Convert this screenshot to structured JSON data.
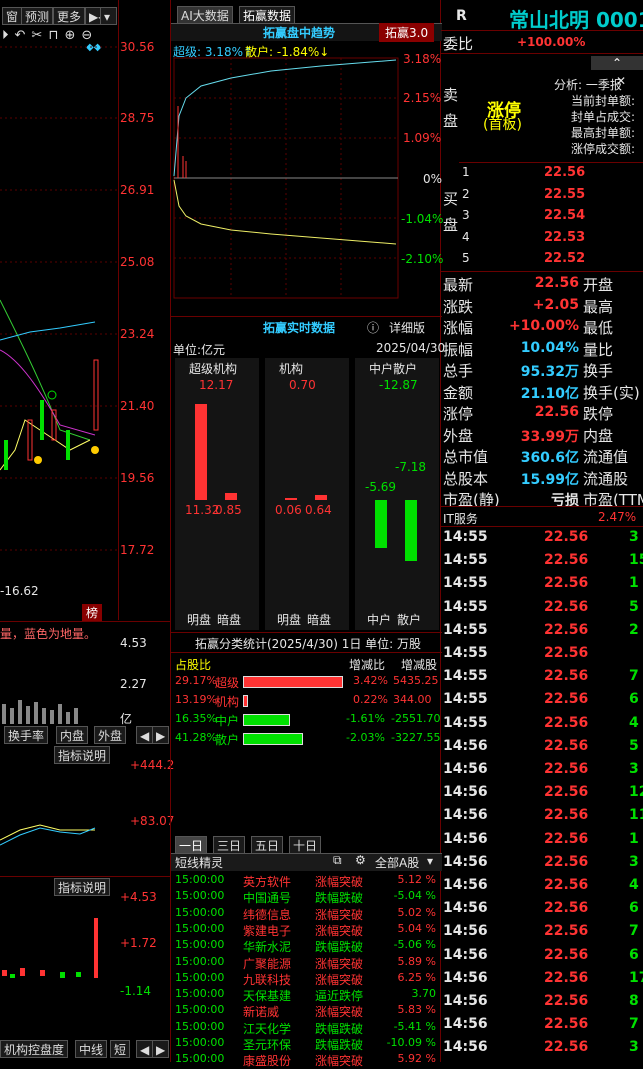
{
  "toolbar": {
    "b1": "窗",
    "b2": "预测",
    "b3": "更多",
    "b4": "▶◀"
  },
  "chart_left": {
    "prices": [
      "30.56",
      "28.75",
      "26.91",
      "25.08",
      "23.24",
      "21.40",
      "19.56",
      "17.72"
    ],
    "low_label": "-16.62",
    "bang": "榜",
    "hint": "量，蓝色为地量。",
    "vol_ticks": [
      "4.53",
      "2.27"
    ],
    "vol_unit": "亿",
    "tabs": [
      "换手率",
      "内盘",
      "外盘"
    ],
    "ind1": "指标说明",
    "ind1_ticks": [
      "+444.2",
      "+83.07"
    ],
    "ind2": "指标说明",
    "ind2_ticks": [
      "+4.53",
      "+1.72",
      "-1.14"
    ],
    "bottom_tabs": [
      "机构控盘度",
      "中线",
      "短"
    ]
  },
  "mid": {
    "tab1": "AI大数据",
    "tab2": "拓赢数据",
    "trend_title": "拓赢盘中趋势",
    "ver": "拓赢3.0",
    "legend_super": "超级: 3.18%↑",
    "legend_retail": "散户: -1.84%↓",
    "y_ticks": [
      "3.18%",
      "2.15%",
      "1.09%",
      "0%",
      "-1.04%",
      "-2.10%"
    ],
    "rt_title": "拓赢实时数据",
    "detail": "详细版",
    "unit": "单位:亿元",
    "date": "2025/04/30",
    "groups": [
      {
        "name": "超级机构",
        "net": "12.17",
        "a": "11.32",
        "b": "0.85",
        "la": "明盘",
        "lb": "暗盘"
      },
      {
        "name": "机构",
        "net": "0.70",
        "a": "0.06",
        "b": "0.64",
        "la": "明盘",
        "lb": "暗盘"
      },
      {
        "name": "中户散户",
        "net": "-12.87",
        "a": "-5.69",
        "b": "-7.18",
        "la": "中户",
        "lb": "散户"
      }
    ],
    "stat_title": "拓赢分类统计(2025/4/30) 1日 单位: 万股",
    "stat_head": [
      "占股比",
      "增减比",
      "增减股"
    ],
    "stats": [
      {
        "pct": "29.17%",
        "name": "超级",
        "chg": "3.42%",
        "sh": "5435.25"
      },
      {
        "pct": "13.19%",
        "name": "机构",
        "chg": "0.22%",
        "sh": "344.00"
      },
      {
        "pct": "16.35%",
        "name": "中户",
        "chg": "-1.61%",
        "sh": "-2551.70"
      },
      {
        "pct": "41.28%",
        "name": "散户",
        "chg": "-2.03%",
        "sh": "-3227.55"
      }
    ],
    "periods": [
      "一日",
      "三日",
      "五日",
      "十日"
    ],
    "spirit": "短线精灵",
    "spirit_filter": "全部A股",
    "events": [
      [
        "15:00:00",
        "英方软件",
        "涨幅突破",
        "5.12 %",
        "r"
      ],
      [
        "15:00:00",
        "中国通号",
        "跌幅跌破",
        "-5.04 %",
        "g"
      ],
      [
        "15:00:00",
        "纬德信息",
        "涨幅突破",
        "5.02 %",
        "r"
      ],
      [
        "15:00:00",
        "紫建电子",
        "涨幅突破",
        "5.04 %",
        "r"
      ],
      [
        "15:00:00",
        "华新水泥",
        "跌幅跌破",
        "-5.06 %",
        "g"
      ],
      [
        "15:00:00",
        "广聚能源",
        "涨幅突破",
        "5.89 %",
        "r"
      ],
      [
        "15:00:00",
        "九联科技",
        "涨幅突破",
        "6.25 %",
        "r"
      ],
      [
        "15:00:00",
        "天保基建",
        "逼近跌停",
        "3.70",
        "g"
      ],
      [
        "15:00:00",
        "新诺威",
        "涨幅突破",
        "5.83 %",
        "r"
      ],
      [
        "15:00:00",
        "江天化学",
        "跌幅跌破",
        "-5.41 %",
        "g"
      ],
      [
        "15:00:00",
        "圣元环保",
        "跌幅跌破",
        "-10.09 %",
        "g"
      ],
      [
        "15:00:00",
        "康盛股份",
        "涨幅突破",
        "5.92 %",
        "r"
      ]
    ]
  },
  "right": {
    "r": "R",
    "title": "常山北明 0001",
    "weibi": "委比",
    "weibi_v": "+100.00%",
    "sell": "卖盘",
    "buy": "买盘",
    "zt": "涨停",
    "zt2": "(首板)",
    "analysis": "分析: 一季报",
    "info": [
      "当前封单额:",
      "封单占成交:",
      "最高封单额:",
      "涨停成交额:"
    ],
    "book": [
      [
        "1",
        "22.56"
      ],
      [
        "2",
        "22.55"
      ],
      [
        "3",
        "22.54"
      ],
      [
        "4",
        "22.53"
      ],
      [
        "5",
        "22.52"
      ]
    ],
    "quote": [
      [
        "最新",
        "22.56",
        "r",
        "开盘"
      ],
      [
        "涨跌",
        "+2.05",
        "r",
        "最高"
      ],
      [
        "涨幅",
        "+10.00%",
        "r",
        "最低"
      ],
      [
        "振幅",
        "10.04%",
        "c",
        "量比"
      ],
      [
        "总手",
        "95.32万",
        "c",
        "换手"
      ],
      [
        "金额",
        "21.10亿",
        "c",
        "换手(实)"
      ],
      [
        "涨停",
        "22.56",
        "r",
        "跌停"
      ],
      [
        "外盘",
        "33.99万",
        "r",
        "内盘"
      ],
      [
        "总市值",
        "360.6亿",
        "c",
        "流通值"
      ],
      [
        "总股本",
        "15.99亿",
        "c",
        "流通股"
      ],
      [
        "市盈(静)",
        "亏损",
        "w",
        "市盈(TTM)"
      ]
    ],
    "sector": "IT服务",
    "sector_pct": "2.47%",
    "ticks": [
      [
        "14:55",
        "22.56",
        "3"
      ],
      [
        "14:55",
        "22.56",
        "15"
      ],
      [
        "14:55",
        "22.56",
        "1"
      ],
      [
        "14:55",
        "22.56",
        "5"
      ],
      [
        "14:55",
        "22.56",
        "2"
      ],
      [
        "14:55",
        "22.56",
        ""
      ],
      [
        "14:55",
        "22.56",
        "7"
      ],
      [
        "14:55",
        "22.56",
        "6"
      ],
      [
        "14:55",
        "22.56",
        "4"
      ],
      [
        "14:56",
        "22.56",
        "5"
      ],
      [
        "14:56",
        "22.56",
        "3"
      ],
      [
        "14:56",
        "22.56",
        "12"
      ],
      [
        "14:56",
        "22.56",
        "11"
      ],
      [
        "14:56",
        "22.56",
        "1"
      ],
      [
        "14:56",
        "22.56",
        "3"
      ],
      [
        "14:56",
        "22.56",
        "4"
      ],
      [
        "14:56",
        "22.56",
        "6"
      ],
      [
        "14:56",
        "22.56",
        "7"
      ],
      [
        "14:56",
        "22.56",
        "6"
      ],
      [
        "14:56",
        "22.56",
        "17"
      ],
      [
        "14:56",
        "22.56",
        "8"
      ],
      [
        "14:56",
        "22.56",
        "7"
      ],
      [
        "14:56",
        "22.56",
        "3"
      ]
    ]
  },
  "colors": {
    "up": "#ff3333",
    "down": "#00e000",
    "cyan": "#33ccff",
    "grid": "#6a0000"
  }
}
